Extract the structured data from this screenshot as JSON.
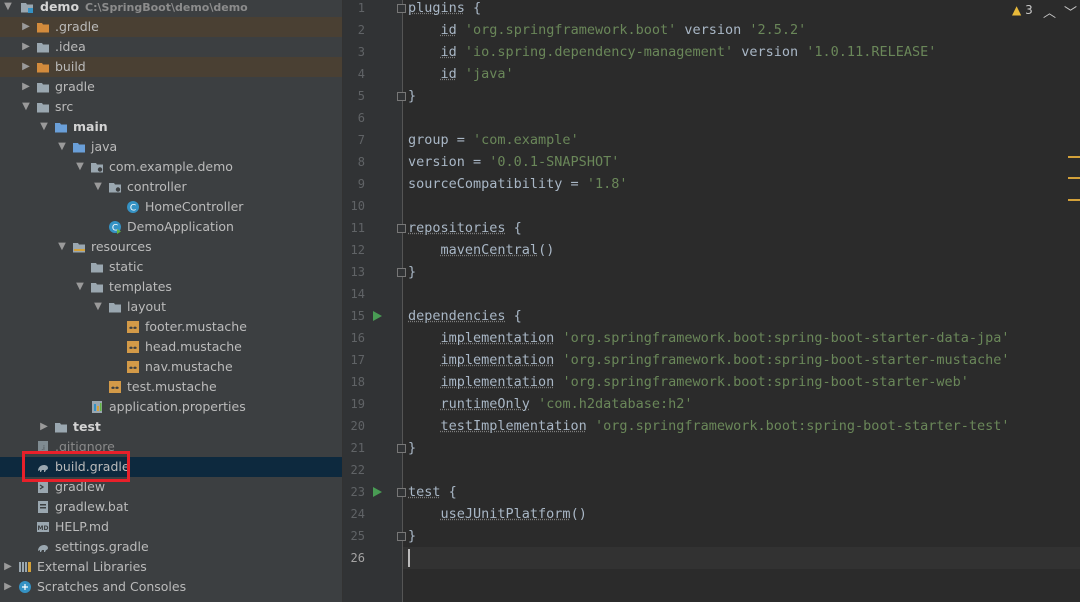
{
  "project_tree": {
    "root": {
      "name": "demo",
      "path": "C:\\SpringBoot\\demo\\demo"
    },
    "items": [
      {
        "label": ".gradle",
        "depth": 1,
        "icon": "folder-orange",
        "expandable": true,
        "excluded": true
      },
      {
        "label": ".idea",
        "depth": 1,
        "icon": "folder",
        "expandable": true
      },
      {
        "label": "build",
        "depth": 1,
        "icon": "folder-orange",
        "expandable": true,
        "excluded": true
      },
      {
        "label": "gradle",
        "depth": 1,
        "icon": "folder",
        "expandable": true
      },
      {
        "label": "src",
        "depth": 1,
        "icon": "folder",
        "expanded": true
      },
      {
        "label": "main",
        "depth": 2,
        "icon": "folder-blue",
        "expanded": true,
        "bold": true
      },
      {
        "label": "java",
        "depth": 3,
        "icon": "folder-blue",
        "expanded": true
      },
      {
        "label": "com.example.demo",
        "depth": 4,
        "icon": "package",
        "expanded": true
      },
      {
        "label": "controller",
        "depth": 5,
        "icon": "package",
        "expanded": true
      },
      {
        "label": "HomeController",
        "depth": 6,
        "icon": "class"
      },
      {
        "label": "DemoApplication",
        "depth": 5,
        "icon": "class-run"
      },
      {
        "label": "resources",
        "depth": 3,
        "icon": "folder-resources",
        "expanded": true
      },
      {
        "label": "static",
        "depth": 4,
        "icon": "folder"
      },
      {
        "label": "templates",
        "depth": 4,
        "icon": "folder",
        "expanded": true
      },
      {
        "label": "layout",
        "depth": 5,
        "icon": "folder",
        "expanded": true
      },
      {
        "label": "footer.mustache",
        "depth": 6,
        "icon": "mustache"
      },
      {
        "label": "head.mustache",
        "depth": 6,
        "icon": "mustache"
      },
      {
        "label": "nav.mustache",
        "depth": 6,
        "icon": "mustache"
      },
      {
        "label": "test.mustache",
        "depth": 5,
        "icon": "mustache"
      },
      {
        "label": "application.properties",
        "depth": 4,
        "icon": "properties"
      },
      {
        "label": "test",
        "depth": 2,
        "icon": "folder",
        "expandable": true,
        "bold": true
      },
      {
        "label": ".gitignore",
        "depth": 1,
        "icon": "gitignore",
        "grayed": true
      },
      {
        "label": "build.gradle",
        "depth": 1,
        "icon": "gradle",
        "selected": true
      },
      {
        "label": "gradlew",
        "depth": 1,
        "icon": "script"
      },
      {
        "label": "gradlew.bat",
        "depth": 1,
        "icon": "bat"
      },
      {
        "label": "HELP.md",
        "depth": 1,
        "icon": "markdown"
      },
      {
        "label": "settings.gradle",
        "depth": 1,
        "icon": "gradle"
      },
      {
        "label": "External Libraries",
        "depth": 0,
        "icon": "libraries",
        "expandable": true
      },
      {
        "label": "Scratches and Consoles",
        "depth": 0,
        "icon": "scratches",
        "expandable": true
      }
    ]
  },
  "editor": {
    "warnings": "3",
    "current_line": 26,
    "lines": [
      [
        {
          "t": "plugins",
          "c": "fn"
        },
        {
          "t": " {",
          "c": "kw"
        }
      ],
      [
        {
          "t": "    ",
          "c": "kw"
        },
        {
          "t": "id",
          "c": "fn"
        },
        {
          "t": " ",
          "c": "kw"
        },
        {
          "t": "'org.springframework.boot'",
          "c": "str"
        },
        {
          "t": " version ",
          "c": "kw"
        },
        {
          "t": "'2.5.2'",
          "c": "str"
        }
      ],
      [
        {
          "t": "    ",
          "c": "kw"
        },
        {
          "t": "id",
          "c": "fn"
        },
        {
          "t": " ",
          "c": "kw"
        },
        {
          "t": "'io.spring.dependency-management'",
          "c": "str"
        },
        {
          "t": " version ",
          "c": "kw"
        },
        {
          "t": "'1.0.11.RELEASE'",
          "c": "str"
        }
      ],
      [
        {
          "t": "    ",
          "c": "kw"
        },
        {
          "t": "id",
          "c": "fn"
        },
        {
          "t": " ",
          "c": "kw"
        },
        {
          "t": "'java'",
          "c": "str"
        }
      ],
      [
        {
          "t": "}",
          "c": "kw"
        }
      ],
      [],
      [
        {
          "t": "group = ",
          "c": "kw"
        },
        {
          "t": "'com.example'",
          "c": "str"
        }
      ],
      [
        {
          "t": "version = ",
          "c": "kw"
        },
        {
          "t": "'0.0.1-SNAPSHOT'",
          "c": "str"
        }
      ],
      [
        {
          "t": "sourceCompatibility = ",
          "c": "kw"
        },
        {
          "t": "'1.8'",
          "c": "str"
        }
      ],
      [],
      [
        {
          "t": "repositories",
          "c": "fn"
        },
        {
          "t": " {",
          "c": "kw"
        }
      ],
      [
        {
          "t": "    ",
          "c": "kw"
        },
        {
          "t": "mavenCentral",
          "c": "fn"
        },
        {
          "t": "()",
          "c": "kw"
        }
      ],
      [
        {
          "t": "}",
          "c": "kw"
        }
      ],
      [],
      [
        {
          "t": "dependencies",
          "c": "fn"
        },
        {
          "t": " {",
          "c": "kw"
        }
      ],
      [
        {
          "t": "    ",
          "c": "kw"
        },
        {
          "t": "implementation",
          "c": "fn"
        },
        {
          "t": " ",
          "c": "kw"
        },
        {
          "t": "'org.springframework.boot:spring-boot-starter-data-jpa'",
          "c": "str"
        }
      ],
      [
        {
          "t": "    ",
          "c": "kw"
        },
        {
          "t": "implementation",
          "c": "fn"
        },
        {
          "t": " ",
          "c": "kw"
        },
        {
          "t": "'org.springframework.boot:spring-boot-starter-mustache'",
          "c": "str"
        }
      ],
      [
        {
          "t": "    ",
          "c": "kw"
        },
        {
          "t": "implementation",
          "c": "fn"
        },
        {
          "t": " ",
          "c": "kw"
        },
        {
          "t": "'org.springframework.boot:spring-boot-starter-web'",
          "c": "str"
        }
      ],
      [
        {
          "t": "    ",
          "c": "kw"
        },
        {
          "t": "runtimeOnly",
          "c": "fn"
        },
        {
          "t": " ",
          "c": "kw"
        },
        {
          "t": "'com.h2database:h2'",
          "c": "str"
        }
      ],
      [
        {
          "t": "    ",
          "c": "kw"
        },
        {
          "t": "testImplementation",
          "c": "fn"
        },
        {
          "t": " ",
          "c": "kw"
        },
        {
          "t": "'org.springframework.boot:spring-boot-starter-test'",
          "c": "str"
        }
      ],
      [
        {
          "t": "}",
          "c": "kw"
        }
      ],
      [],
      [
        {
          "t": "test",
          "c": "fn"
        },
        {
          "t": " {",
          "c": "kw"
        }
      ],
      [
        {
          "t": "    ",
          "c": "kw"
        },
        {
          "t": "useJUnitPlatform",
          "c": "fn"
        },
        {
          "t": "()",
          "c": "kw"
        }
      ],
      [
        {
          "t": "}",
          "c": "kw"
        }
      ],
      []
    ],
    "fold_lines": [
      1,
      5,
      11,
      13,
      21,
      23,
      25
    ],
    "run_lines": [
      15,
      23
    ]
  }
}
